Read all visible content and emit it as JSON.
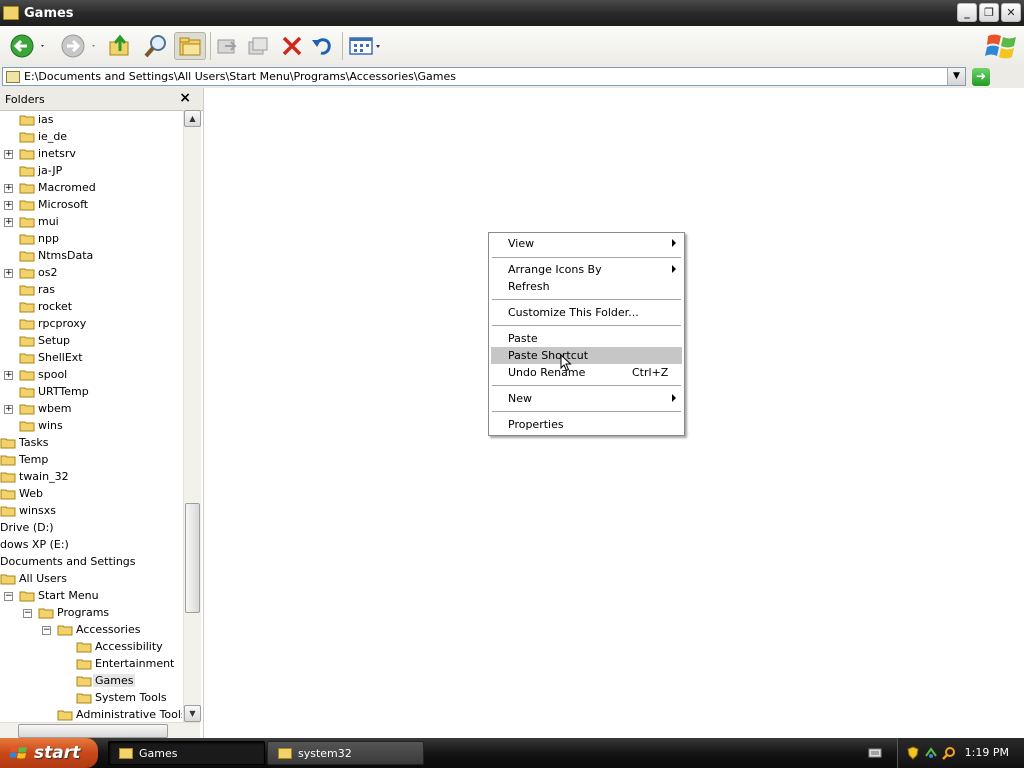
{
  "window": {
    "title": "Games",
    "controls": [
      "minimize",
      "maximize",
      "close"
    ]
  },
  "toolbar": {
    "buttons": [
      "back-icon",
      "forward-icon",
      "up-folder-icon",
      "search-icon",
      "folders-icon",
      "move-to-icon",
      "copy-to-icon",
      "delete-icon",
      "undo-icon",
      "views-icon"
    ]
  },
  "address": {
    "path": "E:\\Documents and Settings\\All Users\\Start Menu\\Programs\\Accessories\\Games"
  },
  "folders_pane": {
    "title": "Folders",
    "close": "×",
    "items": [
      {
        "label": "ias",
        "expander": ""
      },
      {
        "label": "ie_de",
        "expander": ""
      },
      {
        "label": "inetsrv",
        "expander": "+"
      },
      {
        "label": "ja-JP",
        "expander": ""
      },
      {
        "label": "Macromed",
        "expander": "+"
      },
      {
        "label": "Microsoft",
        "expander": "+"
      },
      {
        "label": "mui",
        "expander": "+"
      },
      {
        "label": "npp",
        "expander": ""
      },
      {
        "label": "NtmsData",
        "expander": ""
      },
      {
        "label": "os2",
        "expander": "+"
      },
      {
        "label": "ras",
        "expander": ""
      },
      {
        "label": "rocket",
        "expander": ""
      },
      {
        "label": "rpcproxy",
        "expander": ""
      },
      {
        "label": "Setup",
        "expander": ""
      },
      {
        "label": "ShellExt",
        "expander": ""
      },
      {
        "label": "spool",
        "expander": "+"
      },
      {
        "label": "URTTemp",
        "expander": ""
      },
      {
        "label": "wbem",
        "expander": "+"
      },
      {
        "label": "wins",
        "expander": ""
      },
      {
        "label": "Tasks",
        "expander": ""
      },
      {
        "label": "Temp",
        "expander": ""
      },
      {
        "label": "twain_32",
        "expander": ""
      },
      {
        "label": "Web",
        "expander": ""
      },
      {
        "label": "winsxs",
        "expander": ""
      },
      {
        "label": "Drive (D:)",
        "expander": ""
      },
      {
        "label": "dows XP (E:)",
        "expander": ""
      },
      {
        "label": "Documents and Settings",
        "expander": ""
      },
      {
        "label": "All Users",
        "expander": ""
      },
      {
        "label": "Start Menu",
        "expander": "−"
      },
      {
        "label": "Programs",
        "expander": "−"
      },
      {
        "label": "Accessories",
        "expander": "−"
      },
      {
        "label": "Accessibility",
        "expander": ""
      },
      {
        "label": "Entertainment",
        "expander": ""
      },
      {
        "label": "Games",
        "expander": "",
        "selected": true
      },
      {
        "label": "System Tools",
        "expander": ""
      },
      {
        "label": "Administrative Tools",
        "expander": ""
      }
    ]
  },
  "context_menu": {
    "items": [
      {
        "label": "View",
        "submenu": true
      },
      {
        "label": "Arrange Icons By",
        "submenu": true
      },
      {
        "label": "Refresh"
      },
      {
        "label": "Customize This Folder..."
      },
      {
        "label": "Paste"
      },
      {
        "label": "Paste Shortcut",
        "highlighted": true
      },
      {
        "label": "Undo Rename",
        "shortcut": "Ctrl+Z"
      },
      {
        "label": "New",
        "submenu": true
      },
      {
        "label": "Properties"
      }
    ]
  },
  "taskbar": {
    "start_label": "start",
    "tasks": [
      {
        "label": "Games",
        "active": true
      },
      {
        "label": "system32",
        "active": false
      }
    ],
    "clock": "1:19 PM"
  }
}
